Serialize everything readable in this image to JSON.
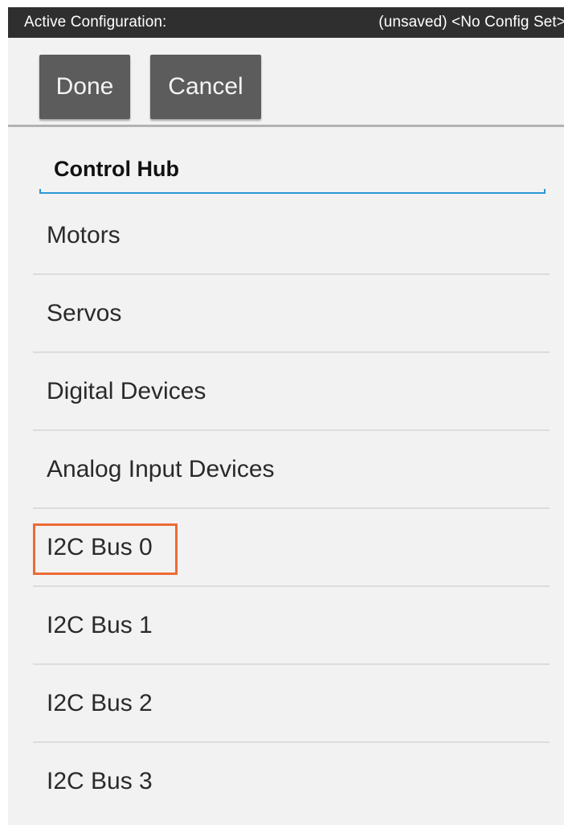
{
  "status_bar": {
    "label": "Active Configuration:",
    "value": "(unsaved) <No Config Set>",
    "background": "#2f2f2f"
  },
  "toolbar": {
    "done_label": "Done",
    "cancel_label": "Cancel"
  },
  "hub": {
    "name": "Control Hub",
    "accent": "#2c97d4"
  },
  "list": {
    "items": [
      {
        "label": "Motors"
      },
      {
        "label": "Servos"
      },
      {
        "label": "Digital Devices"
      },
      {
        "label": "Analog Input Devices"
      },
      {
        "label": "I2C Bus 0",
        "highlighted": true
      },
      {
        "label": "I2C Bus 1"
      },
      {
        "label": "I2C Bus 2"
      },
      {
        "label": "I2C Bus 3"
      }
    ],
    "highlight_color": "#ec6b35"
  }
}
